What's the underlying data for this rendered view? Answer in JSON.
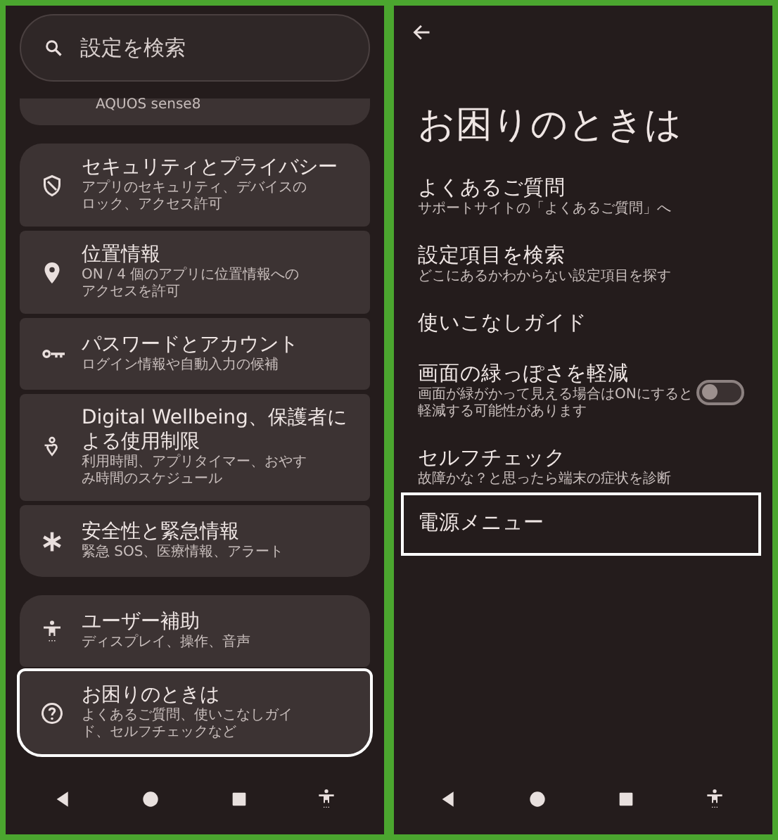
{
  "settings_panel": {
    "search": {
      "placeholder": "設定を検索"
    },
    "partial_item": {
      "subtitle": "AQUOS sense8"
    },
    "groups": [
      {
        "items": [
          {
            "kind": "shield",
            "title": "セキュリティとプライバシー",
            "subtitle": "アプリのセキュリティ、デバイスのロック、アクセス許可",
            "highlighted": false
          },
          {
            "kind": "pin",
            "title": "位置情報",
            "subtitle": "ON / 4 個のアプリに位置情報へのアクセスを許可",
            "highlighted": false
          },
          {
            "kind": "key",
            "title": "パスワードとアカウント",
            "subtitle": "ログイン情報や自動入力の候補",
            "highlighted": false
          },
          {
            "kind": "wellbeing",
            "title": "Digital Wellbeing、保護者による使用制限",
            "subtitle": "利用時間、アプリタイマー、おやすみ時間のスケジュール",
            "highlighted": false
          },
          {
            "kind": "asterisk",
            "title": "安全性と緊急情報",
            "subtitle": "緊急 SOS、医療情報、アラート",
            "highlighted": false
          }
        ]
      },
      {
        "items": [
          {
            "kind": "accessibility",
            "title": "ユーザー補助",
            "subtitle": "ディスプレイ、操作、音声",
            "highlighted": false
          },
          {
            "kind": "help",
            "title": "お困りのときは",
            "subtitle": "よくあるご質問、使いこなしガイド、セルフチェックなど",
            "highlighted": true
          }
        ]
      }
    ]
  },
  "help_panel": {
    "title": "お困りのときは",
    "items": [
      {
        "kind": "link",
        "title": "よくあるご質問",
        "subtitle": "サポートサイトの「よくあるご質問」へ",
        "highlighted": false
      },
      {
        "kind": "link",
        "title": "設定項目を検索",
        "subtitle": "どこにあるかわからない設定項目を探す",
        "highlighted": false
      },
      {
        "kind": "link",
        "title": "使いこなしガイド",
        "highlighted": false
      },
      {
        "kind": "toggle",
        "title": "画面の緑っぽさを軽減",
        "subtitle": "画面が緑がかって見える場合はONにすると軽減する可能性があります",
        "on": false,
        "highlighted": false
      },
      {
        "kind": "link",
        "title": "セルフチェック",
        "subtitle": "故障かな？と思ったら端末の症状を診断",
        "highlighted": false
      },
      {
        "kind": "link",
        "title": "電源メニュー",
        "highlighted": true
      }
    ]
  }
}
